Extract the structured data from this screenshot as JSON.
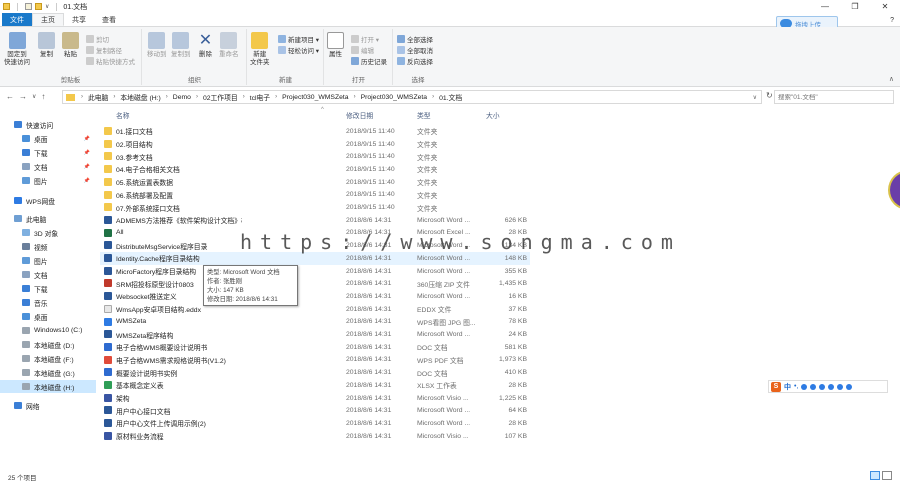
{
  "window": {
    "title": "01.文档",
    "controls": [
      "—",
      "❐",
      "✕"
    ]
  },
  "tabs": {
    "file": "文件",
    "home": "主页",
    "share": "共享",
    "view": "查看"
  },
  "upload_button": "拖拽上传",
  "help_icon": "?",
  "ribbon": {
    "clipboard": {
      "label": "剪贴板",
      "pin": "固定到\n快速访问",
      "copy": "复制",
      "paste": "粘贴",
      "cut": "剪切",
      "copy_path": "复制路径",
      "paste_shortcut": "粘贴快捷方式"
    },
    "organize": {
      "label": "组织",
      "move_to": "移动到",
      "copy_to": "复制到",
      "delete": "删除",
      "rename": "重命名"
    },
    "new": {
      "label": "新建",
      "new_folder": "新建\n文件夹",
      "new_item": "新建项目 ▾",
      "easy_access": "轻松访问 ▾"
    },
    "open": {
      "label": "打开",
      "properties": "属性",
      "open": "打开 ▾",
      "edit": "编辑",
      "history": "历史记录"
    },
    "select": {
      "label": "选择",
      "select_all": "全部选择",
      "select_none": "全部取消",
      "invert": "反向选择"
    }
  },
  "address": {
    "nav": [
      "←",
      "→",
      "∨",
      "↑"
    ],
    "crumbs": [
      "此电脑",
      "本地磁盘 (H:)",
      "Demo",
      "02工作项目",
      "tcl电子",
      "Project030_WMSZeta",
      "Project030_WMSZeta",
      "01.文档"
    ],
    "search_placeholder": "搜索\"01.文档\""
  },
  "sidebar": [
    {
      "label": "快速访问",
      "icon": "star-icon",
      "pin": false
    },
    {
      "label": "桌面",
      "icon": "desktop-icon",
      "pin": true
    },
    {
      "label": "下载",
      "icon": "download-icon",
      "pin": true
    },
    {
      "label": "文档",
      "icon": "document-icon",
      "pin": true
    },
    {
      "label": "图片",
      "icon": "picture-icon",
      "pin": true
    },
    {
      "label": "WPS网盘",
      "icon": "cloud-icon",
      "pin": false
    },
    {
      "label": "此电脑",
      "icon": "computer-icon",
      "pin": false
    },
    {
      "label": "3D 对象",
      "icon": "cube-icon",
      "pin": false
    },
    {
      "label": "视频",
      "icon": "video-icon",
      "pin": false
    },
    {
      "label": "图片",
      "icon": "picture-icon",
      "pin": false
    },
    {
      "label": "文档",
      "icon": "document-icon",
      "pin": false
    },
    {
      "label": "下载",
      "icon": "download-icon",
      "pin": false
    },
    {
      "label": "音乐",
      "icon": "music-icon",
      "pin": false
    },
    {
      "label": "桌面",
      "icon": "desktop-icon",
      "pin": false
    },
    {
      "label": "Windows10 (C:)",
      "icon": "drive-icon",
      "pin": false
    },
    {
      "label": "本地磁盘 (D:)",
      "icon": "drive-icon",
      "pin": false
    },
    {
      "label": "本地磁盘 (F:)",
      "icon": "drive-icon",
      "pin": false
    },
    {
      "label": "本地磁盘 (G:)",
      "icon": "drive-icon",
      "pin": false
    },
    {
      "label": "本地磁盘 (H:)",
      "icon": "drive-icon",
      "pin": false
    },
    {
      "label": "网络",
      "icon": "network-icon",
      "pin": false
    }
  ],
  "columns": {
    "name": "名称",
    "date": "修改日期",
    "type": "类型",
    "size": "大小"
  },
  "files": [
    {
      "name": "01.接口文档",
      "date": "2018/9/15 11:40",
      "type": "文件夹",
      "size": "",
      "kind": "folder"
    },
    {
      "name": "02.项目结构",
      "date": "2018/9/15 11:40",
      "type": "文件夹",
      "size": "",
      "kind": "folder"
    },
    {
      "name": "03.参考文档",
      "date": "2018/9/15 11:40",
      "type": "文件夹",
      "size": "",
      "kind": "folder"
    },
    {
      "name": "04.电子合格相关文档",
      "date": "2018/9/15 11:40",
      "type": "文件夹",
      "size": "",
      "kind": "folder"
    },
    {
      "name": "05.系统运置表数据",
      "date": "2018/9/15 11:40",
      "type": "文件夹",
      "size": "",
      "kind": "folder"
    },
    {
      "name": "06.系统部署及配置",
      "date": "2018/9/15 11:40",
      "type": "文件夹",
      "size": "",
      "kind": "folder"
    },
    {
      "name": "07.外部系统接口文档",
      "date": "2018/9/15 11:40",
      "type": "文件夹",
      "size": "",
      "kind": "folder"
    },
    {
      "name": "ADMEMS方法推荐《软件架构设计文档》模板 v2",
      "date": "2018/8/6 14:31",
      "type": "Microsoft Word ...",
      "size": "626 KB",
      "kind": "doc"
    },
    {
      "name": "All",
      "date": "2018/8/6 14:31",
      "type": "Microsoft Excel ...",
      "size": "28 KB",
      "kind": "xls"
    },
    {
      "name": "DistributeMsgService程序目录",
      "date": "2018/8/6 14:31",
      "type": "Microsoft Word ...",
      "size": "134 KB",
      "kind": "doc"
    },
    {
      "name": "Identity.Cache程序目录结构",
      "date": "2018/8/6 14:31",
      "type": "Microsoft Word ...",
      "size": "148 KB",
      "kind": "doc"
    },
    {
      "name": "MicroFactory程序目录结构",
      "date": "2018/8/6 14:31",
      "type": "Microsoft Word ...",
      "size": "355 KB",
      "kind": "doc"
    },
    {
      "name": "SRM招投标原型设计0803",
      "date": "2018/8/6 14:31",
      "type": "360压缩 ZIP 文件",
      "size": "1,435 KB",
      "kind": "zip"
    },
    {
      "name": "Websocket推送定义",
      "date": "2018/8/6 14:31",
      "type": "Microsoft Word ...",
      "size": "16 KB",
      "kind": "doc"
    },
    {
      "name": "WmsApp安卓项目结构.eddx",
      "date": "2018/8/6 14:31",
      "type": "EDDX 文件",
      "size": "37 KB",
      "kind": "blank"
    },
    {
      "name": "WMSZeta",
      "date": "2018/8/6 14:31",
      "type": "WPS看图 JPG 图...",
      "size": "78 KB",
      "kind": "jpg"
    },
    {
      "name": "WMSZeta程序结构",
      "date": "2018/8/6 14:31",
      "type": "Microsoft Word ...",
      "size": "24 KB",
      "kind": "doc"
    },
    {
      "name": "电子合格WMS概要设计说明书",
      "date": "2018/8/6 14:31",
      "type": "DOC 文档",
      "size": "581 KB",
      "kind": "wpsdoc"
    },
    {
      "name": "电子合格WMS需求规格说明书(V1.2)",
      "date": "2018/8/6 14:31",
      "type": "WPS PDF 文档",
      "size": "1,973 KB",
      "kind": "pdf"
    },
    {
      "name": "概要设计说明书实例",
      "date": "2018/8/6 14:31",
      "type": "DOC 文档",
      "size": "410 KB",
      "kind": "wpsdoc"
    },
    {
      "name": "基本概念定义表",
      "date": "2018/8/6 14:31",
      "type": "XLSX 工作表",
      "size": "28 KB",
      "kind": "xlsx"
    },
    {
      "name": "架构",
      "date": "2018/8/6 14:31",
      "type": "Microsoft Visio ...",
      "size": "1,225 KB",
      "kind": "vsd"
    },
    {
      "name": "用户中心接口文档",
      "date": "2018/8/6 14:31",
      "type": "Microsoft Word ...",
      "size": "64 KB",
      "kind": "doc"
    },
    {
      "name": "用户中心文件上传调用示例(2)",
      "date": "2018/8/6 14:31",
      "type": "Microsoft Word ...",
      "size": "28 KB",
      "kind": "doc"
    },
    {
      "name": "原材料业务流程",
      "date": "2018/8/6 14:31",
      "type": "Microsoft Visio ...",
      "size": "107 KB",
      "kind": "vsd"
    }
  ],
  "tooltip": {
    "type": "类型: Microsoft Word 文档",
    "author": "作者: 张胜刚",
    "size": "大小: 147 KB",
    "modified": "修改日期: 2018/8/6 14:31"
  },
  "watermark": "https://www.songma.com",
  "ime": {
    "logo": "S",
    "lang": "中"
  },
  "status": {
    "count": "25 个项目"
  },
  "colors": {
    "accent": "#1979ca",
    "folder": "#f3c84b",
    "word": "#2b5797",
    "selection": "#cce8ff"
  }
}
